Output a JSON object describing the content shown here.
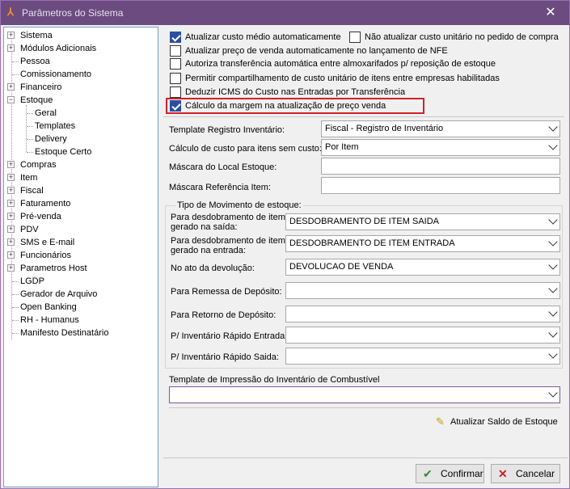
{
  "window": {
    "title": "Parâmetros do Sistema"
  },
  "tree": {
    "items": [
      {
        "label": "Sistema",
        "expander": "+"
      },
      {
        "label": "Módulos Adicionais",
        "expander": "+"
      },
      {
        "label": "Pessoa",
        "expander": ""
      },
      {
        "label": "Comissionamento",
        "expander": ""
      },
      {
        "label": "Financeiro",
        "expander": "+"
      },
      {
        "label": "Estoque",
        "expander": "−"
      },
      {
        "label": "Geral",
        "expander": ""
      },
      {
        "label": "Templates",
        "expander": ""
      },
      {
        "label": "Delivery",
        "expander": ""
      },
      {
        "label": "Estoque Certo",
        "expander": ""
      },
      {
        "label": "Compras",
        "expander": "+"
      },
      {
        "label": "Item",
        "expander": "+"
      },
      {
        "label": "Fiscal",
        "expander": "+"
      },
      {
        "label": "Faturamento",
        "expander": "+"
      },
      {
        "label": "Pré-venda",
        "expander": "+"
      },
      {
        "label": "PDV",
        "expander": "+"
      },
      {
        "label": "SMS e E-mail",
        "expander": "+"
      },
      {
        "label": "Funcionários",
        "expander": "+"
      },
      {
        "label": "Parametros Host",
        "expander": "+"
      },
      {
        "label": "LGDP",
        "expander": ""
      },
      {
        "label": "Gerador de Arquivo",
        "expander": ""
      },
      {
        "label": "Open Banking",
        "expander": ""
      },
      {
        "label": "RH - Humanus",
        "expander": ""
      },
      {
        "label": "Manifesto Destinatário",
        "expander": ""
      }
    ]
  },
  "options": {
    "checkboxes": [
      {
        "label": "Atualizar custo médio automaticamente",
        "checked": true
      },
      {
        "label": "Não atualizar custo unitário no pedido de compra",
        "checked": false
      },
      {
        "label": "Atualizar preço de venda automaticamente no lançamento de NFE",
        "checked": false
      },
      {
        "label": "Autoriza transferência automática entre almoxarifados p/ reposição de estoque",
        "checked": false
      },
      {
        "label": "Permitir compartilhamento de custo unitário de itens entre empresas habilitadas",
        "checked": false
      },
      {
        "label": "Deduzir ICMS do Custo nas Entradas por Transferência",
        "checked": false
      },
      {
        "label": "Cálculo da margem na atualização de preço venda",
        "checked": true
      }
    ]
  },
  "fields": {
    "template_registro_label": "Template Registro Inventário:",
    "template_registro_value": "Fiscal - Registro de Inventário",
    "calculo_custo_label": "Cálculo de custo para itens sem custo:",
    "calculo_custo_value": "Por Item",
    "mascara_local_label": "Máscara do Local Estoque:",
    "mascara_ref_label": "Máscara Referência Item:"
  },
  "movimento": {
    "title": "Tipo de Movimento de estoque:",
    "rows": [
      {
        "label": "Para desdobramento de item gerado na saída:",
        "value": "DESDOBRAMENTO DE ITEM SAIDA"
      },
      {
        "label": "Para desdobramento de item gerado na entrada:",
        "value": "DESDOBRAMENTO DE ITEM ENTRADA"
      },
      {
        "label": "No ato da devolução:",
        "value": "DEVOLUCAO DE VENDA"
      },
      {
        "label": "Para Remessa de Depósito:",
        "value": ""
      },
      {
        "label": "Para Retorno de Depósito:",
        "value": ""
      },
      {
        "label": "P/ Inventário Rápido Entrada:",
        "value": ""
      },
      {
        "label": "P/ Inventário Rápido Saida:",
        "value": ""
      }
    ]
  },
  "combustivel": {
    "label": "Template de Impressão do Inventário de Combustível",
    "value": ""
  },
  "actions": {
    "atualizar_saldo": "Atualizar Saldo de Estoque",
    "confirmar": "Confirmar",
    "cancelar": "Cancelar"
  },
  "colors": {
    "titlebar": "#6b4b80",
    "highlight": "#d4202a",
    "checkbox_checked": "#2b4fa0"
  }
}
